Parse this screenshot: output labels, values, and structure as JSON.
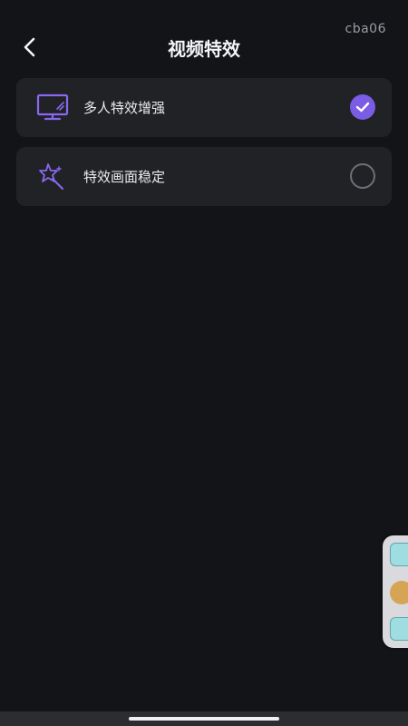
{
  "device_tag": "cba06",
  "header": {
    "title": "视频特效",
    "back_icon": "chevron-left-icon"
  },
  "options": [
    {
      "label": "多人特效增强",
      "icon": "monitor-icon",
      "selected": true
    },
    {
      "label": "特效画面稳定",
      "icon": "sparkle-wand-icon",
      "selected": false
    }
  ],
  "colors": {
    "background": "#131417",
    "card": "#202226",
    "accent": "#7b5ce5",
    "text": "#ececef"
  }
}
